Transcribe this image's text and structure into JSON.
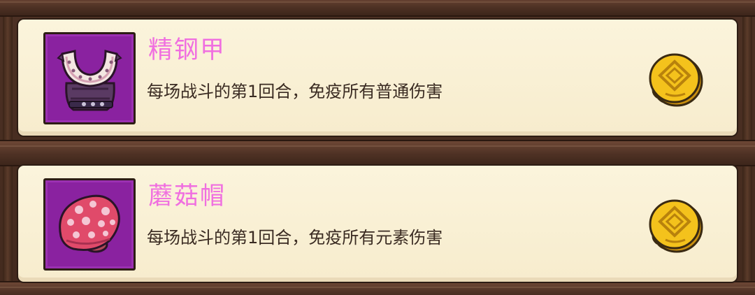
{
  "items": [
    {
      "name": "精钢甲",
      "description": "每场战斗的第1回合，免疫所有普通伤害",
      "icon": "steel-armor-icon"
    },
    {
      "name": "蘑菇帽",
      "description": "每场战斗的第1回合，免疫所有元素伤害",
      "icon": "mushroom-hat-icon"
    }
  ],
  "colors": {
    "item_name": "#f06fe0",
    "icon_frame": "#8a22a0",
    "card_bg": "#fbf4dc",
    "coin": "#f4c21c"
  }
}
